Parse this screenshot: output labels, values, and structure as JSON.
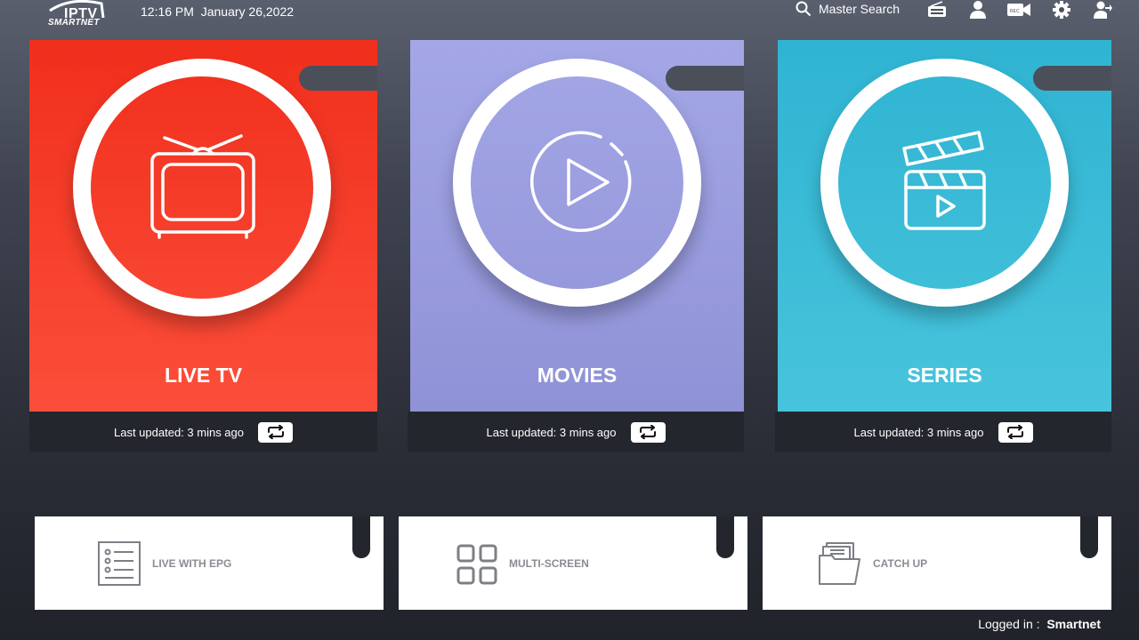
{
  "header": {
    "logo_text": "IPTV",
    "logo_sub": "SMARTNET",
    "time": "12:16 PM",
    "date": "January 26,2022",
    "search_label": "Master Search",
    "icons": [
      "radio-icon",
      "user-icon",
      "rec-icon",
      "gear-icon",
      "switch-user-icon"
    ]
  },
  "cards": [
    {
      "title": "LIVE TV",
      "updated": "Last updated: 3 mins ago",
      "color": "#f3372a",
      "icon": "tv-icon"
    },
    {
      "title": "MOVIES",
      "updated": "Last updated: 3 mins ago",
      "color": "#9a9ddd",
      "icon": "play-icon"
    },
    {
      "title": "SERIES",
      "updated": "Last updated: 3 mins ago",
      "color": "#38b8d4",
      "icon": "clapper-icon"
    }
  ],
  "tiles": [
    {
      "label": "LIVE WITH EPG",
      "icon": "list-icon"
    },
    {
      "label": "MULTI-SCREEN",
      "icon": "grid-icon"
    },
    {
      "label": "CATCH UP",
      "icon": "folder-icon"
    }
  ],
  "footer": {
    "logged_label": "Logged in :",
    "user": "Smartnet"
  }
}
